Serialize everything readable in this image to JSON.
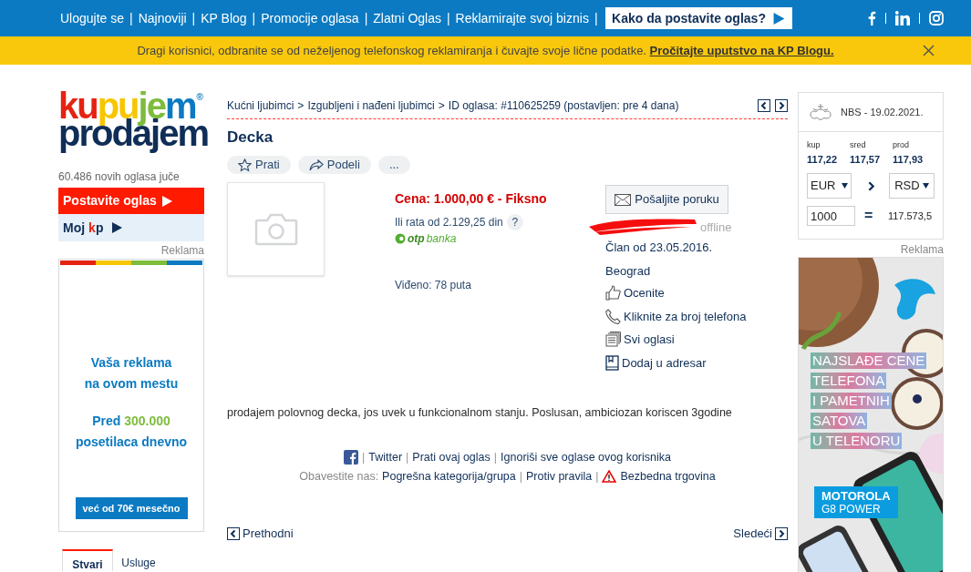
{
  "top_nav": {
    "links": [
      "Ulogujte se",
      "Najnoviji",
      "KP Blog",
      "Promocije oglasa",
      "Zlatni Oglas",
      "Reklamirajte svoj biznis"
    ],
    "separator": "|",
    "cta": "Kako da postavite oglas?"
  },
  "notice": {
    "text": "Dragi korisnici, odbranite se od neželjenog telefonskog reklamiranja i čuvajte svoje lične podatke.",
    "link": "Pročitajte uputstvo na KP Blogu."
  },
  "logo": {
    "top": [
      {
        "text": "ku",
        "color": "#e52313"
      },
      {
        "text": "pu",
        "color": "#f6c600"
      },
      {
        "text": "je",
        "color": "#7dbc3c"
      },
      {
        "text": "m",
        "color": "#0b7ac2"
      }
    ],
    "mark": "®",
    "bottom": "prodajem"
  },
  "sidebar": {
    "new_ads": "60.486 novih oglasa juče",
    "post_ad": "Postavite oglas",
    "my_kp": {
      "prefix": "Moj",
      "brand": [
        {
          "text": "k",
          "color": "#e52313"
        },
        {
          "text": "p",
          "color": "#0f2e57"
        }
      ]
    },
    "ad_label": "Reklama",
    "ad": {
      "line1": "Vaša reklama",
      "line2": "na ovom mestu",
      "prefix": "Pred",
      "number": "300.000",
      "line4": "posetilaca dnevno",
      "button": "već od 70€ mesečno"
    },
    "tabs": [
      {
        "label": "Stvari",
        "selected": true
      },
      {
        "label": "Usluge",
        "selected": false
      }
    ]
  },
  "breadcrumb": {
    "items": [
      "Kućni ljubimci",
      "Izgubljeni i nađeni ljubimci",
      "ID oglasa: #110625259 (postavljen: pre 4 dana)"
    ],
    "separator": ">"
  },
  "title": "Decka",
  "actions": [
    {
      "kind": "star",
      "label": "Prati"
    },
    {
      "kind": "share",
      "label": "Podeli"
    },
    {
      "kind": "more",
      "label": "..."
    }
  ],
  "price": {
    "text": "Cena: 1.000,00 € - Fiksno",
    "installment": "Ili rata od 2.129,25 din",
    "help": "?",
    "bank": [
      "otp",
      "banka"
    ],
    "views": "Viđeno: 78 puta"
  },
  "seller": {
    "message_button": "Pošaljite poruku",
    "status": "offline",
    "member_since": "Član od 23.05.2016.",
    "city": "Beograd",
    "links": [
      {
        "kind": "thumb",
        "label": "Ocenite"
      },
      {
        "kind": "phone",
        "label": "Kliknite za broj telefona"
      },
      {
        "kind": "list",
        "label": "Svi oglasi"
      },
      {
        "kind": "book",
        "label": "Dodaj u adresar"
      }
    ]
  },
  "description": "prodajem polovnog decka, jos uvek u funkcionalnom stanju. Poslusan, ambiciozan koriscen 3godine",
  "share_row": {
    "links": [
      "Twitter",
      "Prati ovaj oglas",
      "Ignoriši sve oglase ovog korisnika"
    ],
    "separator": "|"
  },
  "report": {
    "label": "Obavestite nas:",
    "links": [
      "Pogrešna kategorija/grupa",
      "Protiv pravila"
    ],
    "safe": "Bezbedna trgovina"
  },
  "pager": {
    "prev": "Prethodni",
    "next": "Sledeći"
  },
  "exchange": {
    "title": "NBS - 19.02.2021.",
    "rates": [
      {
        "label": "kup",
        "value": "117,22"
      },
      {
        "label": "sred",
        "value": "117,57"
      },
      {
        "label": "prod",
        "value": "117,93"
      }
    ],
    "from": "EUR",
    "to": "RSD",
    "amount": "1000",
    "equals": "=",
    "result": "117.573,5"
  },
  "right_ad": {
    "label": "Reklama",
    "lines": [
      "NAJSLAĐE CENE",
      "TELEFONA",
      "I PAMETNIH",
      "SATOVA",
      "U TELENORU"
    ],
    "promo": [
      "MOTOROLA",
      "G8 POWER"
    ]
  }
}
